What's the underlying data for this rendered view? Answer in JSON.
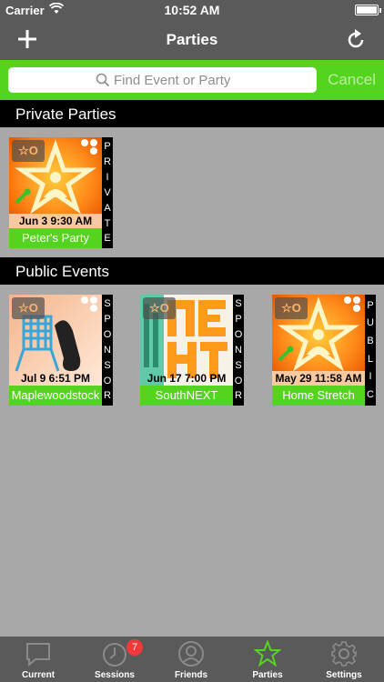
{
  "status_bar": {
    "carrier": "Carrier",
    "time": "10:52 AM"
  },
  "nav": {
    "title": "Parties",
    "add_icon": "plus-icon",
    "refresh_icon": "refresh-icon"
  },
  "search": {
    "placeholder": "Find Event or Party",
    "cancel_label": "Cancel"
  },
  "sections": {
    "private_title": "Private Parties",
    "public_title": "Public Events"
  },
  "private_parties": [
    {
      "date": "Jun 3 9:30 AM",
      "name": "Peter's Party",
      "tag": [
        "P",
        "R",
        "I",
        "V",
        "A",
        "T",
        "E"
      ]
    }
  ],
  "public_events": [
    {
      "date": "Jul 9 6:51 PM",
      "name": "Maplewoodstock",
      "tag": [
        "S",
        "P",
        "O",
        "N",
        "S",
        "O",
        "R"
      ]
    },
    {
      "date": "Jun 17 7:00 PM",
      "name": "SouthNEXT",
      "tag": [
        "S",
        "P",
        "O",
        "N",
        "S",
        "O",
        "R"
      ]
    },
    {
      "date": "May 29 11:58 AM",
      "name": "Home Stretch",
      "tag": [
        "P",
        "U",
        "B",
        "L",
        "I",
        "C"
      ]
    }
  ],
  "tabs": [
    {
      "label": "Current",
      "icon": "chat-bubble-icon"
    },
    {
      "label": "Sessions",
      "icon": "clock-icon",
      "badge": "7"
    },
    {
      "label": "Friends",
      "icon": "person-icon"
    },
    {
      "label": "Parties",
      "icon": "star-icon",
      "active": true
    },
    {
      "label": "Settings",
      "icon": "gear-icon"
    }
  ],
  "colors": {
    "accent_green": "#55d41f",
    "bar_gray": "#5a5a5a",
    "badge_red": "#f03a3a"
  }
}
